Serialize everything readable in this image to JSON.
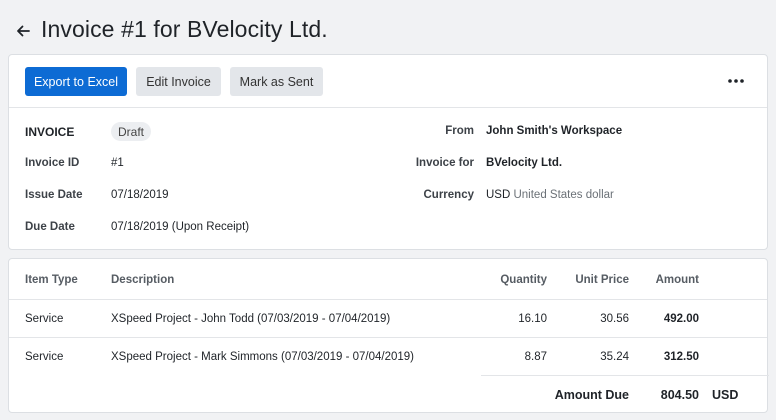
{
  "header": {
    "title": "Invoice #1 for BVelocity Ltd."
  },
  "toolbar": {
    "export_label": "Export to Excel",
    "edit_label": "Edit Invoice",
    "sent_label": "Mark as Sent",
    "more_icon": "more-horizontal-icon"
  },
  "invoice": {
    "heading": "INVOICE",
    "status": "Draft",
    "id_label": "Invoice ID",
    "id_value": "#1",
    "issue_label": "Issue Date",
    "issue_value": "07/18/2019",
    "due_label": "Due Date",
    "due_value": "07/18/2019 (Upon Receipt)",
    "from_label": "From",
    "from_value": "John Smith's Workspace",
    "for_label": "Invoice for",
    "for_value": "BVelocity Ltd.",
    "currency_label": "Currency",
    "currency_code": "USD",
    "currency_name": "United States dollar"
  },
  "table": {
    "headers": {
      "item_type": "Item Type",
      "description": "Description",
      "quantity": "Quantity",
      "unit_price": "Unit Price",
      "amount": "Amount"
    },
    "rows": [
      {
        "item_type": "Service",
        "description": "XSpeed Project - John Todd (07/03/2019 - 07/04/2019)",
        "quantity": "16.10",
        "unit_price": "30.56",
        "amount": "492.00"
      },
      {
        "item_type": "Service",
        "description": "XSpeed Project - Mark Simmons (07/03/2019 - 07/04/2019)",
        "quantity": "8.87",
        "unit_price": "35.24",
        "amount": "312.50"
      }
    ],
    "total_label": "Amount Due",
    "total_value": "804.50",
    "total_currency": "USD"
  },
  "colors": {
    "primary": "#0d6bd4",
    "background": "#f1f2f4"
  }
}
